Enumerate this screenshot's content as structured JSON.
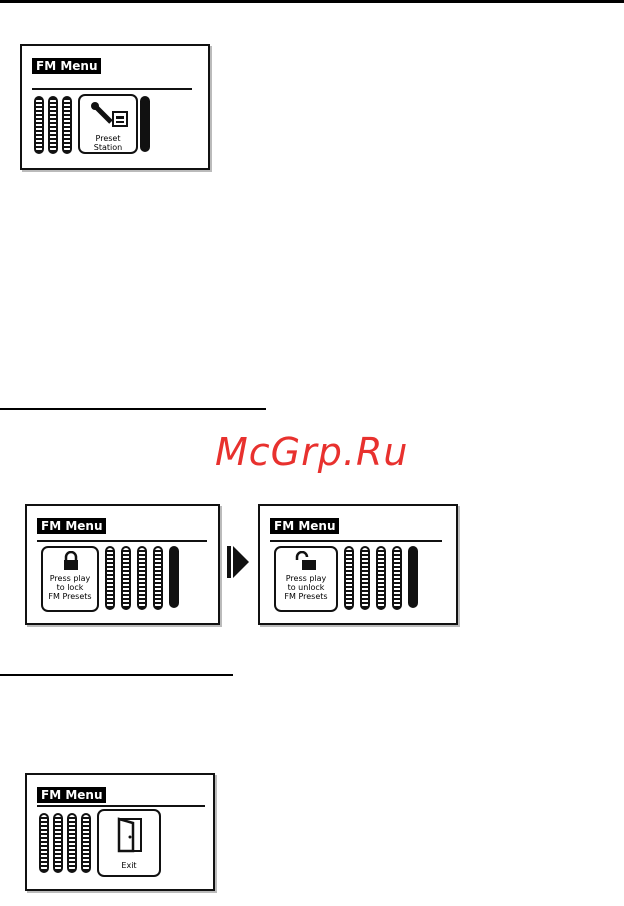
{
  "menu_title": "FM Menu",
  "screens": {
    "preset": {
      "caption": "Preset\nStation"
    },
    "lock": {
      "caption": "Press play\nto lock\nFM Presets"
    },
    "unlock": {
      "caption": "Press play\nto unlock\nFM Presets"
    },
    "exit": {
      "caption": "Exit"
    }
  },
  "watermark": "McGrp.Ru"
}
